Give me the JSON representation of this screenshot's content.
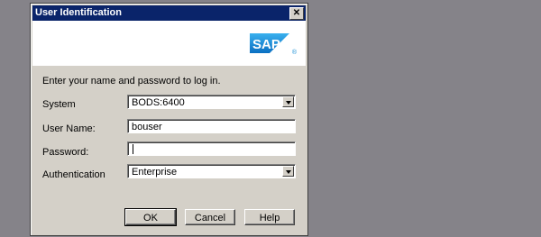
{
  "window": {
    "title": "User Identification",
    "close_symbol": "✕"
  },
  "banner": {
    "logo_text": "SAP",
    "logo_mark": "®"
  },
  "intro_text": "Enter your name and password to log in.",
  "fields": {
    "system": {
      "label": "System",
      "value": "BODS:6400"
    },
    "username": {
      "label": "User Name:",
      "value": "bouser"
    },
    "password": {
      "label": "Password:",
      "value": ""
    },
    "authentication": {
      "label": "Authentication",
      "value": "Enterprise"
    }
  },
  "buttons": {
    "ok": "OK",
    "cancel": "Cancel",
    "help": "Help"
  },
  "colors": {
    "titlebar": "#0a246a",
    "dialog": "#d4d0c8",
    "background": "#858389",
    "sap_blue": "#1b8fd6"
  }
}
